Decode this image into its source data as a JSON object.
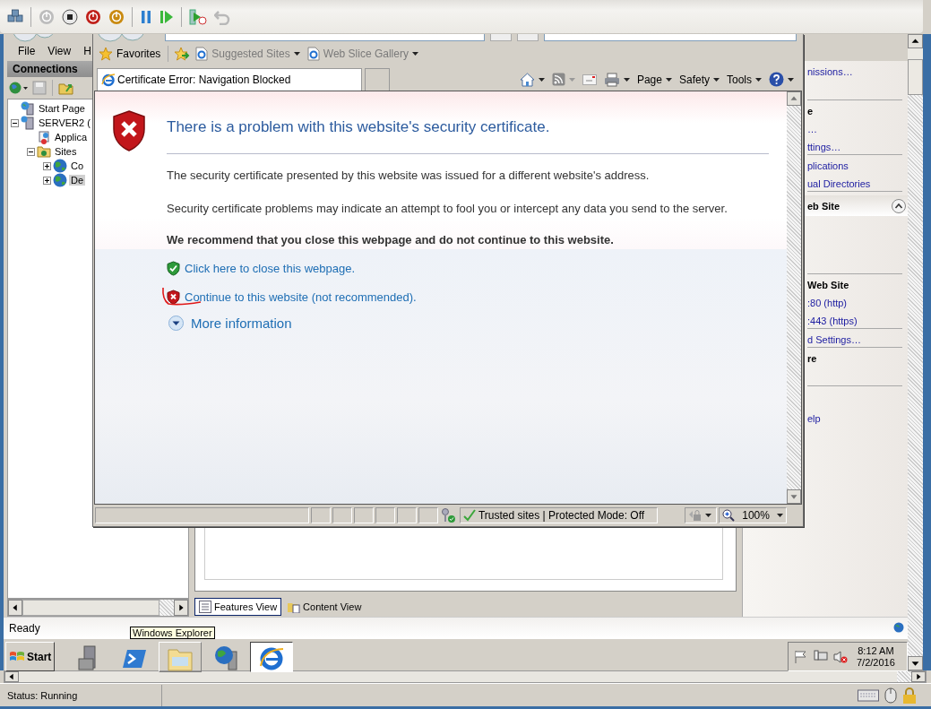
{
  "iis": {
    "menu": [
      "File",
      "View",
      "H"
    ],
    "connections_title": "Connections",
    "tree": [
      {
        "label": "Start Page",
        "kind": "start",
        "selected": false
      },
      {
        "label": "SERVER2 (",
        "kind": "server",
        "selected": false,
        "expanded": true,
        "children": [
          {
            "label": "Applica",
            "kind": "pool",
            "selected": false
          },
          {
            "label": "Sites",
            "kind": "sites",
            "selected": false,
            "expanded": true,
            "children": [
              {
                "label": "Co",
                "kind": "site",
                "selected": false,
                "expanded": false
              },
              {
                "label": "De",
                "kind": "site",
                "selected": true,
                "expanded": false
              }
            ]
          }
        ]
      }
    ],
    "action_groups": [
      {
        "items": [
          {
            "kind": "link",
            "label": "nissions…"
          }
        ]
      },
      {
        "items": [
          {
            "kind": "header",
            "label": "e"
          },
          {
            "kind": "link",
            "label": "…"
          },
          {
            "kind": "link",
            "label": "ttings…"
          }
        ]
      },
      {
        "items": [
          {
            "kind": "link",
            "label": "plications"
          },
          {
            "kind": "link",
            "label": "ual Directories"
          }
        ]
      },
      {
        "items": [
          {
            "kind": "section",
            "label": "eb Site",
            "expanded": true
          }
        ]
      },
      {
        "items": [
          {
            "kind": "header",
            "label": "Web Site"
          },
          {
            "kind": "link",
            "label": ":80 (http)"
          },
          {
            "kind": "link",
            "label": ":443 (https)"
          }
        ]
      },
      {
        "items": [
          {
            "kind": "link",
            "label": "d Settings…"
          }
        ]
      },
      {
        "items": [
          {
            "kind": "header",
            "label": "re"
          }
        ]
      },
      {
        "items": [
          {
            "kind": "link",
            "label": "elp"
          }
        ]
      }
    ],
    "views": [
      {
        "label": "Features View",
        "selected": true
      },
      {
        "label": "Content View",
        "selected": false
      }
    ],
    "status": "Ready"
  },
  "ie": {
    "favorites": {
      "label": "Favorites",
      "links": [
        "Suggested Sites",
        "Web Slice Gallery"
      ]
    },
    "tab": "Certificate Error: Navigation Blocked",
    "commands": [
      "Page",
      "Safety",
      "Tools"
    ],
    "error": {
      "title": "There is a problem with this website's security certificate.",
      "paragraphs": [
        "The security certificate presented by this website was issued for a different website's address.",
        "Security certificate problems may indicate an attempt to fool you or intercept any data you send to the server."
      ],
      "recommendation": "We recommend that you close this webpage and do not continue to this website.",
      "options": [
        {
          "kind": "safe",
          "label": "Click here to close this webpage."
        },
        {
          "kind": "unsafe",
          "label": "Continue to this website (not recommended).",
          "marked": true
        }
      ],
      "more": "More information"
    },
    "status": {
      "zone": "Trusted sites | Protected Mode: Off",
      "zoom": "100%"
    }
  },
  "taskbar": {
    "start": "Start",
    "tooltip": "Windows Explorer",
    "items": [
      {
        "kind": "server-manager",
        "active": false
      },
      {
        "kind": "powershell",
        "active": false
      },
      {
        "kind": "explorer",
        "active": false
      },
      {
        "kind": "iis",
        "active": false
      },
      {
        "kind": "ie",
        "active": true
      }
    ],
    "time": "8:12 AM",
    "date": "7/2/2016"
  },
  "vm_status": "Status: Running"
}
